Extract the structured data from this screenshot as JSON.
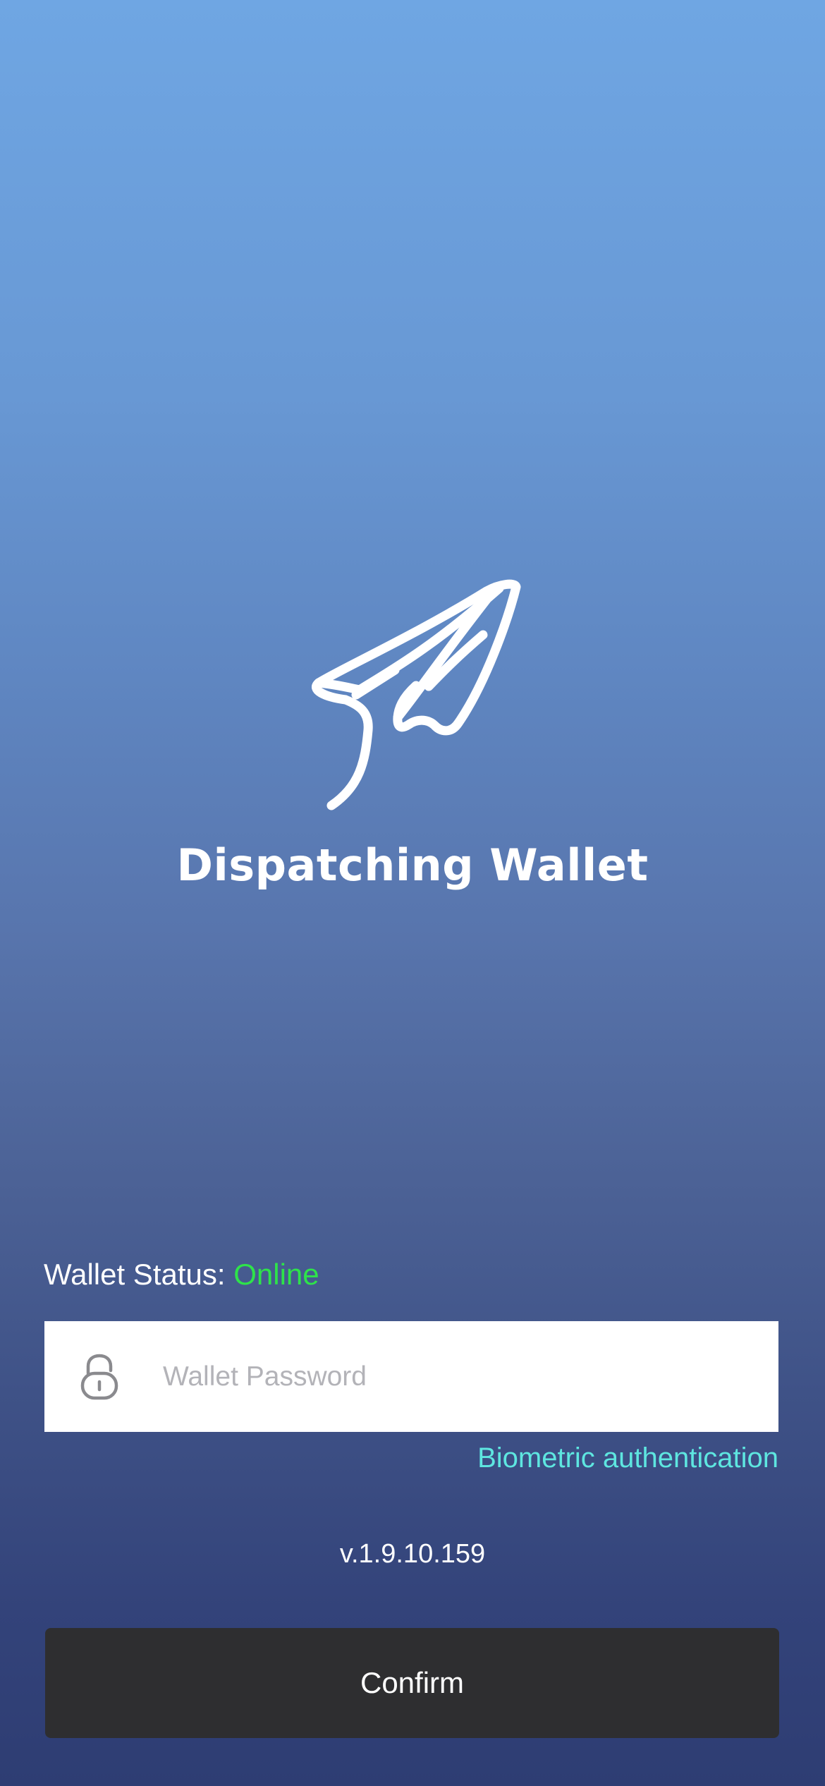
{
  "app": {
    "title": "Dispatching Wallet",
    "logo_icon": "paper-plane-hand-icon"
  },
  "status": {
    "label": "Wallet Status:",
    "value": "Online",
    "value_color": "#2ee34a"
  },
  "password": {
    "icon": "lock-icon",
    "placeholder": "Wallet Password",
    "value": ""
  },
  "biometric": {
    "label": "Biometric authentication",
    "color": "#5ee6e0"
  },
  "version": "v.1.9.10.159",
  "confirm": {
    "label": "Confirm"
  }
}
